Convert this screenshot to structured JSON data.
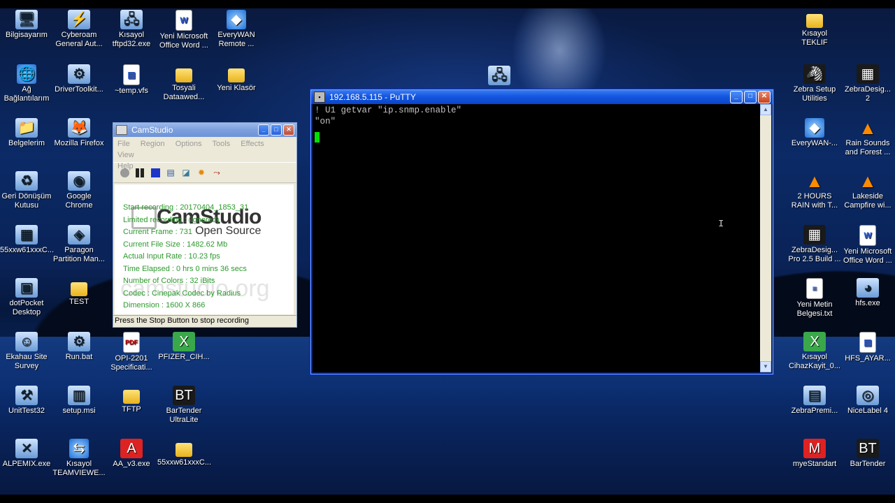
{
  "desktop": {
    "icons_left": [
      {
        "label": "Bilgisayarım",
        "icon": "computer-icon",
        "glyph": "🖥"
      },
      {
        "label": "Cyberoam\nGeneral Aut...",
        "icon": "cyberoam-icon",
        "glyph": "⚡"
      },
      {
        "label": "Kısayol\ntftpd32.exe",
        "icon": "tftpd-icon",
        "glyph": "🖧"
      },
      {
        "label": "Yeni Microsoft\nOffice Word ...",
        "icon": "word-doc-icon",
        "glyph": "W"
      },
      {
        "label": "EveryWAN\nRemote ...",
        "icon": "everywan-icon",
        "glyph": "◆"
      },
      {
        "label": "Ağ\nBağlantılarım",
        "icon": "network-icon",
        "glyph": "🌐"
      },
      {
        "label": "DriverToolkit...",
        "icon": "drivertoolkit-icon",
        "glyph": "⚙"
      },
      {
        "label": "~temp.vfs",
        "icon": "vfs-file-icon",
        "glyph": "▤"
      },
      {
        "label": "Tosyali\nDataawed...",
        "icon": "folder-icon",
        "glyph": ""
      },
      {
        "label": "Yeni Klasör",
        "icon": "folder-icon",
        "glyph": ""
      },
      {
        "label": "Belgelerim",
        "icon": "documents-icon",
        "glyph": "📁"
      },
      {
        "label": "Mozilla Firefox",
        "icon": "firefox-icon",
        "glyph": "🦊"
      },
      {
        "label": "Geri Dönüşüm\nKutusu",
        "icon": "recycle-bin-icon",
        "glyph": "♻"
      },
      {
        "label": "Google\nChrome",
        "icon": "chrome-icon",
        "glyph": "◉"
      },
      {
        "label": "55xxw61xxxC...",
        "icon": "zip-icon",
        "glyph": "▦"
      },
      {
        "label": "Paragon\nPartition Man...",
        "icon": "paragon-icon",
        "glyph": "◈"
      },
      {
        "label": "dotPocket\nDesktop",
        "icon": "dotpocket-icon",
        "glyph": "▣"
      },
      {
        "label": "TEST",
        "icon": "folder-icon",
        "glyph": ""
      },
      {
        "label": "Ekahau Site\nSurvey",
        "icon": "ekahau-icon",
        "glyph": "☺"
      },
      {
        "label": "Run.bat",
        "icon": "bat-file-icon",
        "glyph": "⚙"
      },
      {
        "label": "OPI-2201\nSpecificati...",
        "icon": "pdf-icon",
        "glyph": "PDF"
      },
      {
        "label": "PFIZER_CIH...",
        "icon": "excel-icon",
        "glyph": "X"
      },
      {
        "label": "UnitTest32",
        "icon": "unittest-icon",
        "glyph": "⚒"
      },
      {
        "label": "setup.msi",
        "icon": "msi-icon",
        "glyph": "▥"
      },
      {
        "label": "TFTP",
        "icon": "folder-icon",
        "glyph": ""
      },
      {
        "label": "BarTender\nUltraLite",
        "icon": "bartender-icon",
        "glyph": "BT"
      },
      {
        "label": "ALPEMIX.exe",
        "icon": "alpemix-icon",
        "glyph": "✕"
      },
      {
        "label": "Kısayol\nTEAMVIEWE...",
        "icon": "teamviewer-icon",
        "glyph": "⇆"
      },
      {
        "label": "AA_v3.exe",
        "icon": "ammyy-icon",
        "glyph": "A"
      },
      {
        "label": "55xxw61xxxC...",
        "icon": "folder-icon",
        "glyph": ""
      }
    ],
    "icons_right": [
      {
        "label": "Kısayol\nTEKLIF",
        "icon": "folder-icon",
        "glyph": ""
      },
      {
        "label": "Zebra Setup\nUtilities",
        "icon": "zebra-setup-icon",
        "glyph": "🦓"
      },
      {
        "label": "ZebraDesig...\n2",
        "icon": "zebradesigner-icon",
        "glyph": "▦"
      },
      {
        "label": "EveryWAN-...",
        "icon": "everywan-icon",
        "glyph": "◆"
      },
      {
        "label": "Rain Sounds\nand Forest ...",
        "icon": "vlc-icon",
        "glyph": "▲"
      },
      {
        "label": "2 HOURS\nRAIN with T...",
        "icon": "vlc-icon",
        "glyph": "▲"
      },
      {
        "label": "Lakeside\nCampfire wi...",
        "icon": "vlc-icon",
        "glyph": "▲"
      },
      {
        "label": "ZebraDesig...\nPro 2.5 Build ...",
        "icon": "zebradesigner-pro-icon",
        "glyph": "▦"
      },
      {
        "label": "Yeni Microsoft\nOffice Word ...",
        "icon": "word-doc-icon",
        "glyph": "W"
      },
      {
        "label": "Yeni Metin\nBelgesi.txt",
        "icon": "text-file-icon",
        "glyph": "≡"
      },
      {
        "label": "hfs.exe",
        "icon": "hfs-icon",
        "glyph": "◕"
      },
      {
        "label": "Kısayol\nCihazKayit_0...",
        "icon": "excel-icon",
        "glyph": "X"
      },
      {
        "label": "HFS_AYAR...",
        "icon": "ini-file-icon",
        "glyph": "▤"
      },
      {
        "label": "ZebraPremi...",
        "icon": "zebrapremier-icon",
        "glyph": "▤"
      },
      {
        "label": "NiceLabel 4",
        "icon": "nicelabel-icon",
        "glyph": "◎"
      },
      {
        "label": "myeStandart",
        "icon": "myestandart-icon",
        "glyph": "M"
      },
      {
        "label": "BarTender",
        "icon": "bartender-icon",
        "glyph": "BT"
      }
    ]
  },
  "putty": {
    "title": "192.168.5.115 - PuTTY",
    "lines": [
      "! U1 getvar \"ip.snmp.enable\"",
      "\"on\""
    ],
    "ibeam": "I"
  },
  "camstudio": {
    "title": "CamStudio",
    "menu": [
      "File",
      "Region",
      "Options",
      "Tools",
      "Effects",
      "View",
      "Help"
    ],
    "logo_main": "CamStudio",
    "logo_sub": "Open Source",
    "watermark": "camstudio.org",
    "stats": [
      "Start recording : 20170404_1853_31",
      "Limited recording : (ignored)",
      "Current Frame : 731",
      "Current File Size : 1482.62 Mb",
      "Actual Input Rate : 10.23 fps",
      "Time Elapsed : 0 hrs 0 mins 36 secs",
      "Number of Colors : 32 iBits",
      "Codec : Cinepak Codec by Radius",
      "Dimension : 1600 X 866"
    ],
    "status": "Press the Stop Button to stop recording"
  }
}
